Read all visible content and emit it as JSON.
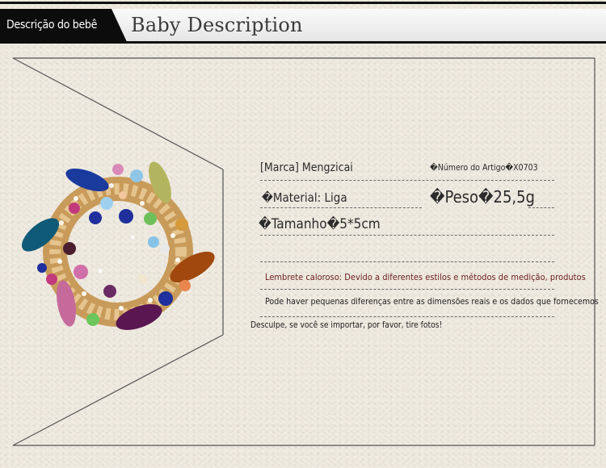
{
  "header": {
    "tag_label": "Descrição do bebê",
    "title": "Baby Description"
  },
  "specs": {
    "brand": "[Marca] Mengzicai",
    "item_number": "�Número do Artigo�X0703",
    "material": "�Material: Liga",
    "weight": "�Peso�25,5g",
    "size": "�Tamanho�5*5cm"
  },
  "notes": {
    "reminder": "Lembrete caloroso: Devido a diferentes estilos e métodos de medição, produtos",
    "differences": "Pode haver pequenas diferenças entre as dimensões reais e os dados que fornecemos",
    "apology": "Desculpe, se você se importar, por favor, tire fotos!"
  },
  "colors": {
    "header_tag": "#0c0c0c",
    "reminder_text": "#6d2020",
    "background": "#efeadf"
  },
  "image": {
    "subject": "crystal-flower-wreath-brooch"
  }
}
